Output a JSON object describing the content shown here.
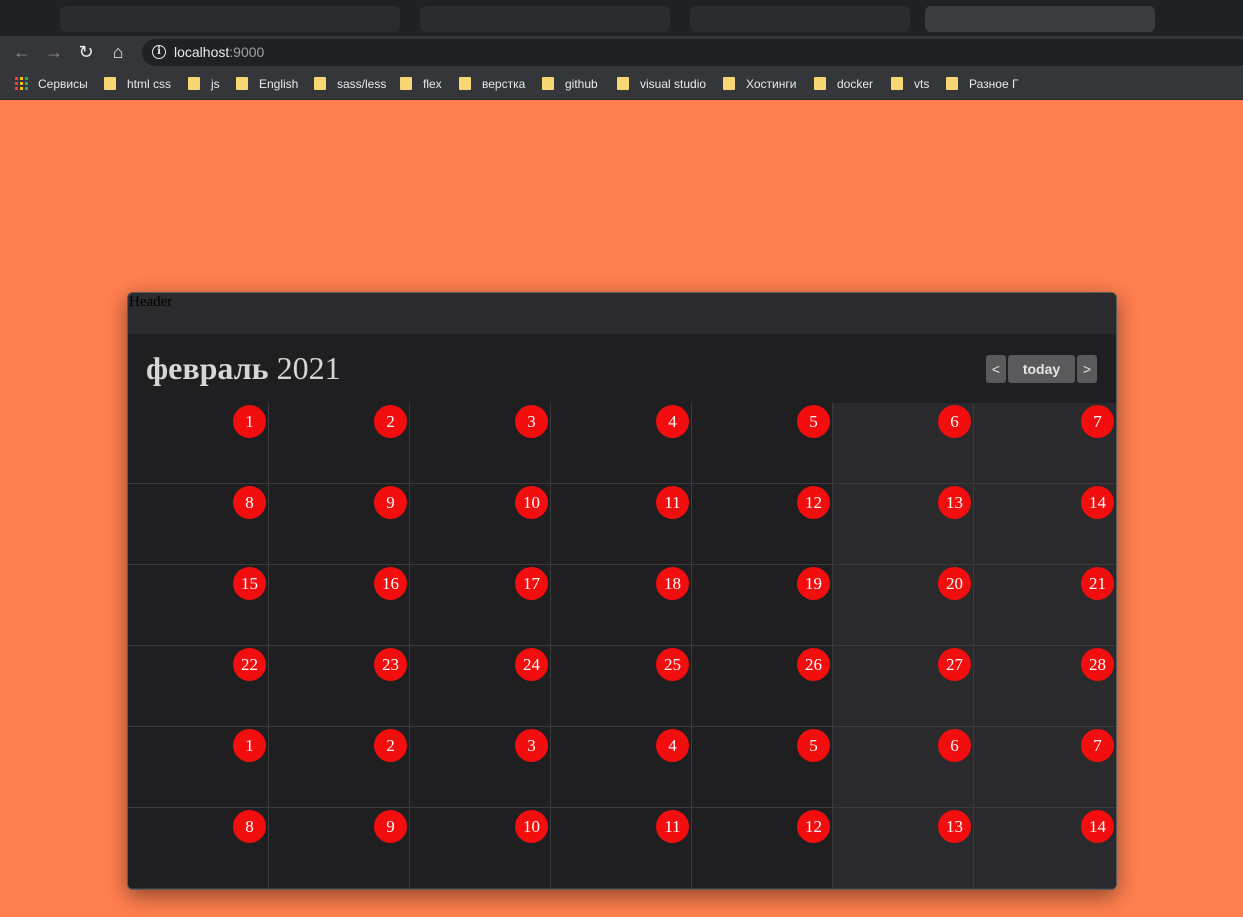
{
  "browser": {
    "url_host": "localhost",
    "url_port": ":9000",
    "bookmarks": [
      "Сервисы",
      "html css",
      "js",
      "English",
      "sass/less",
      "flex",
      "верстка",
      "github",
      "visual studio",
      "Хостинги",
      "docker",
      "vts",
      "Разное Г"
    ]
  },
  "widget": {
    "header_label": "Header",
    "calendar": {
      "month": "февраль",
      "year": "2021",
      "prev_label": "<",
      "today_label": "today",
      "next_label": ">",
      "weeks": [
        [
          "1",
          "2",
          "3",
          "4",
          "5",
          "6",
          "7"
        ],
        [
          "8",
          "9",
          "10",
          "11",
          "12",
          "13",
          "14"
        ],
        [
          "15",
          "16",
          "17",
          "18",
          "19",
          "20",
          "21"
        ],
        [
          "22",
          "23",
          "24",
          "25",
          "26",
          "27",
          "28"
        ],
        [
          "1",
          "2",
          "3",
          "4",
          "5",
          "6",
          "7"
        ],
        [
          "8",
          "9",
          "10",
          "11",
          "12",
          "13",
          "14"
        ]
      ]
    }
  },
  "colors": {
    "page_background": "#ff7f4f",
    "day_badge": "#f20e0e",
    "calendar_background": "#1f1f21",
    "weekend_background": "#2a2a2c"
  }
}
